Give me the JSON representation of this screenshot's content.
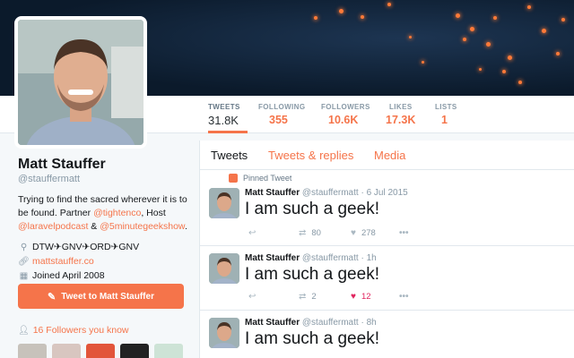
{
  "profile": {
    "name": "Matt Stauffer",
    "handle": "@stauffermatt",
    "bio_part1": "Trying to find the sacred wherever it is to be found. Partner ",
    "bio_link1": "@tightenco",
    "bio_part2": ", Host ",
    "bio_link2": "@laravelpodcast",
    "bio_part3": " & ",
    "bio_link3": "@5minutegeekshow",
    "bio_part4": ".",
    "location": "DTW✈GNV✈ORD✈GNV",
    "website": "mattstauffer.co",
    "joined": "Joined April 2008",
    "tweet_to_label": "Tweet to Matt Stauffer",
    "followers_you_know": "16 Followers you know"
  },
  "stats": [
    {
      "label": "TWEETS",
      "value": "31.8K"
    },
    {
      "label": "FOLLOWING",
      "value": "355"
    },
    {
      "label": "FOLLOWERS",
      "value": "10.6K"
    },
    {
      "label": "LIKES",
      "value": "17.3K"
    },
    {
      "label": "LISTS",
      "value": "1"
    }
  ],
  "timeline": {
    "tabs": [
      "Tweets",
      "Tweets & replies",
      "Media"
    ],
    "pinned_label": "Pinned Tweet",
    "tweets": [
      {
        "name": "Matt Stauffer",
        "handle": "@stauffermatt",
        "time": "· 6 Jul 2015",
        "text": "I am such a geek!",
        "retweets": "80",
        "likes": "278"
      },
      {
        "name": "Matt Stauffer",
        "handle": "@stauffermatt",
        "time": "· 1h",
        "text": "I am such a geek!",
        "retweets": "2",
        "likes": "12"
      },
      {
        "name": "Matt Stauffer",
        "handle": "@stauffermatt",
        "time": "· 8h",
        "text": "I am such a geek!",
        "retweets": "",
        "likes": ""
      }
    ]
  },
  "colors": {
    "accent": "#f5744a",
    "like_active": "#e0245e"
  }
}
